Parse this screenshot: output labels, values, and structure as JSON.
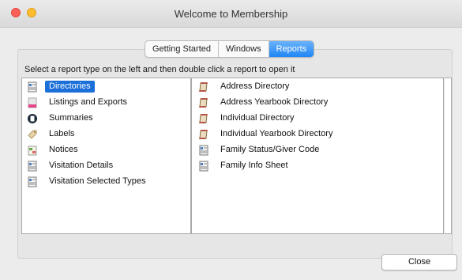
{
  "window": {
    "title": "Welcome to Membership"
  },
  "tabs": [
    {
      "label": "Getting Started",
      "selected": false
    },
    {
      "label": "Windows",
      "selected": false
    },
    {
      "label": "Reports",
      "selected": true
    }
  ],
  "instruction": "Select a report type on the left and then double click a report to open it",
  "report_types": [
    {
      "label": "Directories",
      "icon": "document-icon",
      "selected": true
    },
    {
      "label": "Listings and Exports",
      "icon": "listing-export-icon",
      "selected": false
    },
    {
      "label": "Summaries",
      "icon": "summary-icon",
      "selected": false
    },
    {
      "label": "Labels",
      "icon": "tag-icon",
      "selected": false
    },
    {
      "label": "Notices",
      "icon": "notice-icon",
      "selected": false
    },
    {
      "label": "Visitation Details",
      "icon": "document-icon",
      "selected": false
    },
    {
      "label": "Visitation Selected Types",
      "icon": "document-icon",
      "selected": false
    }
  ],
  "reports": [
    {
      "label": "Address Directory",
      "icon": "scroll-icon"
    },
    {
      "label": "Address Yearbook Directory",
      "icon": "scroll-icon"
    },
    {
      "label": "Individual Directory",
      "icon": "scroll-icon"
    },
    {
      "label": "Individual Yearbook Directory",
      "icon": "scroll-icon"
    },
    {
      "label": "Family Status/Giver Code",
      "icon": "document-icon"
    },
    {
      "label": "Family Info Sheet",
      "icon": "document-icon"
    }
  ],
  "buttons": {
    "close": "Close"
  },
  "colors": {
    "selection": "#1a6fd9",
    "tab_selected": "#1e86f5",
    "close_light": "#fd5f57",
    "minimize_light": "#febc2e"
  }
}
